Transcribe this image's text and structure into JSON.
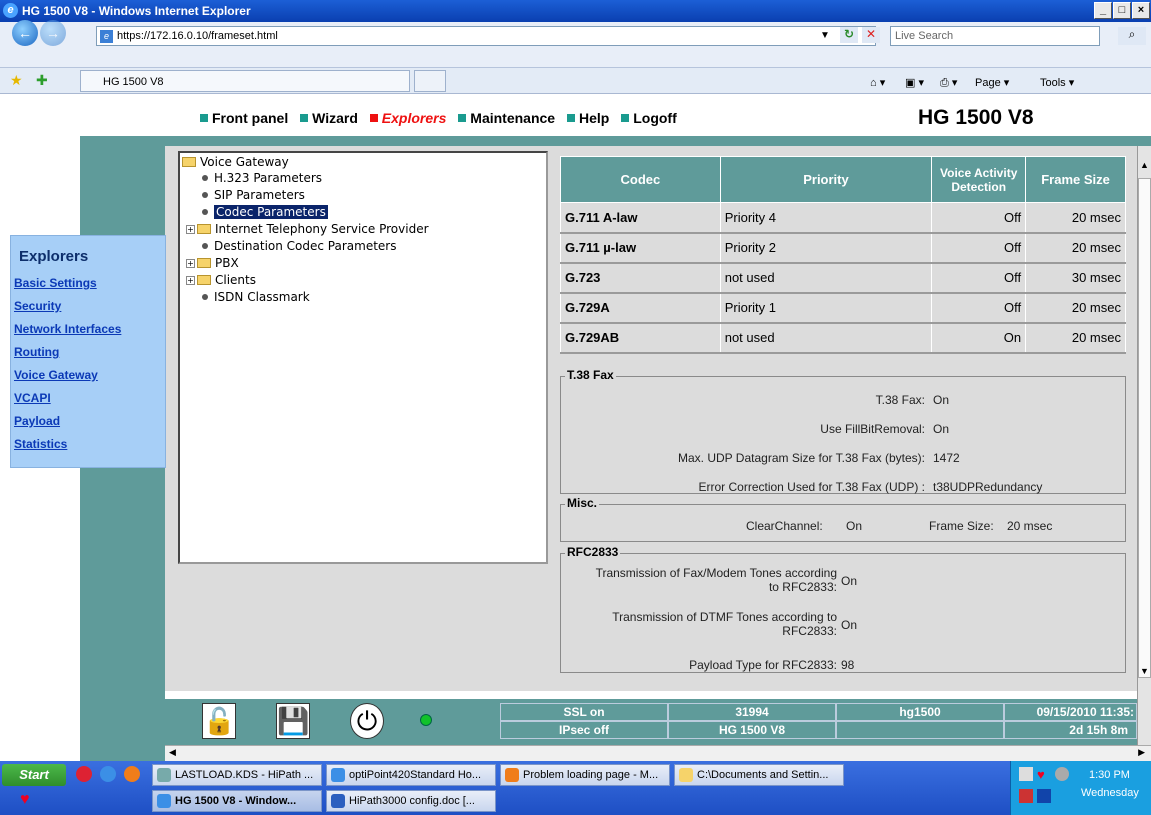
{
  "window": {
    "title": "HG 1500 V8 - Windows Internet Explorer"
  },
  "browser": {
    "url": "https://172.16.0.10/frameset.html",
    "search_placeholder": "Live Search",
    "tab_title": "HG 1500 V8",
    "commands": [
      "Page",
      "Tools"
    ]
  },
  "topnav": {
    "items": [
      "Front panel",
      "Wizard",
      "Explorers",
      "Maintenance",
      "Help",
      "Logoff"
    ],
    "active": "Explorers"
  },
  "product": "HG 1500 V8",
  "explorers": {
    "heading": "Explorers",
    "links": [
      "Basic Settings",
      "Security",
      "Network Interfaces",
      "Routing",
      "Voice Gateway",
      "VCAPI",
      "Payload",
      "Statistics"
    ]
  },
  "tree": {
    "root": "Voice Gateway",
    "items": [
      {
        "label": "H.323 Parameters",
        "type": "leaf"
      },
      {
        "label": "SIP Parameters",
        "type": "leaf"
      },
      {
        "label": "Codec Parameters",
        "type": "leaf",
        "selected": true
      },
      {
        "label": "Internet Telephony Service Provider",
        "type": "folder"
      },
      {
        "label": "Destination Codec Parameters",
        "type": "leaf"
      },
      {
        "label": "PBX",
        "type": "folder"
      },
      {
        "label": "Clients",
        "type": "folder"
      },
      {
        "label": "ISDN Classmark",
        "type": "leaf"
      }
    ]
  },
  "codec_table": {
    "headers": [
      "Codec",
      "Priority",
      "Voice Activity Detection",
      "Frame Size"
    ],
    "rows": [
      {
        "codec": "G.711 A-law",
        "priority": "Priority 4",
        "vad": "Off",
        "frame": "20 msec"
      },
      {
        "codec": "G.711 µ-law",
        "priority": "Priority 2",
        "vad": "Off",
        "frame": "20 msec"
      },
      {
        "codec": "G.723",
        "priority": "not used",
        "vad": "Off",
        "frame": "30 msec"
      },
      {
        "codec": "G.729A",
        "priority": "Priority 1",
        "vad": "Off",
        "frame": "20 msec"
      },
      {
        "codec": "G.729AB",
        "priority": "not used",
        "vad": "On",
        "frame": "20 msec"
      }
    ]
  },
  "t38": {
    "legend": "T.38 Fax",
    "fields": [
      {
        "label": "T.38 Fax:",
        "value": "On"
      },
      {
        "label": "Use FillBitRemoval:",
        "value": "On"
      },
      {
        "label": "Max. UDP Datagram Size for T.38 Fax (bytes):",
        "value": "1472"
      },
      {
        "label": "Error Correction Used for T.38 Fax (UDP) :",
        "value": "t38UDPRedundancy"
      }
    ]
  },
  "misc": {
    "legend": "Misc.",
    "clearchannel_label": "ClearChannel:",
    "clearchannel_value": "On",
    "framesize_label": "Frame Size:",
    "framesize_value": "20 msec"
  },
  "rfc2833": {
    "legend": "RFC2833",
    "fields": [
      {
        "label": "Transmission of Fax/Modem Tones according to RFC2833:",
        "value": "On"
      },
      {
        "label": "Transmission of DTMF Tones according to RFC2833:",
        "value": "On"
      },
      {
        "label": "Payload Type for RFC2833:",
        "value": "98"
      }
    ]
  },
  "statusbar": {
    "row1": [
      "SSL on",
      "31994",
      "hg1500",
      "09/15/2010 11:35:"
    ],
    "row2": [
      "IPsec off",
      "HG 1500 V8",
      "",
      "2d 15h 8m"
    ]
  },
  "taskbar": {
    "start": "Start",
    "tasks_row1": [
      "LASTLOAD.KDS - HiPath ...",
      "optiPoint420Standard Ho...",
      "Problem loading page - M...",
      "C:\\Documents and Settin..."
    ],
    "tasks_row2": [
      "HG 1500 V8 - Window...",
      "HiPath3000 config.doc [..."
    ],
    "time": "1:30 PM",
    "day": "Wednesday"
  }
}
